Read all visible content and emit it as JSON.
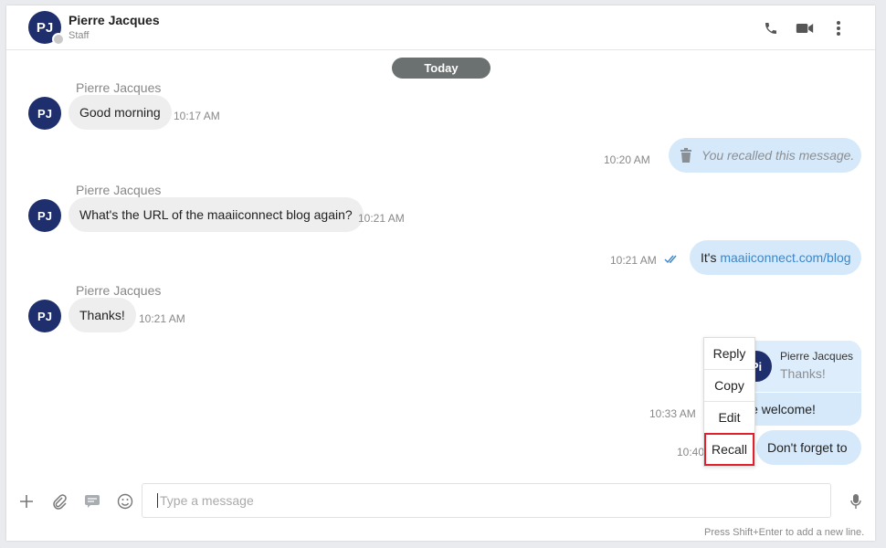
{
  "header": {
    "avatar_initials": "PJ",
    "name": "Pierre Jacques",
    "role": "Staff",
    "icons": [
      "phone-icon",
      "video-camera-icon",
      "more-vertical-icon"
    ]
  },
  "date_divider": "Today",
  "messages": [
    {
      "direction": "in",
      "sender": "Pierre Jacques",
      "avatar": "PJ",
      "text": "Good morning",
      "time": "10:17 AM"
    },
    {
      "direction": "out",
      "text": "You recalled this message.",
      "time": "10:20 AM",
      "recalled": true
    },
    {
      "direction": "in",
      "sender": "Pierre Jacques",
      "avatar": "PJ",
      "text": "What's the URL of the maaiiconnect blog again?",
      "time": "10:21 AM"
    },
    {
      "direction": "out",
      "text_prefix": "It's ",
      "link": "maaiiconnect.com/blog",
      "time": "10:21 AM",
      "read": true
    },
    {
      "direction": "in",
      "sender": "Pierre Jacques",
      "avatar": "PJ",
      "text": "Thanks!",
      "time": "10:21 AM"
    },
    {
      "direction": "out",
      "quote_sender": "Pierre Jacques",
      "quote_avatar": "Pi",
      "quote_text": "Thanks!",
      "text": "u're welcome!",
      "time": "10:33 AM"
    },
    {
      "direction": "out",
      "text": "Don't forget to",
      "time": "10:40"
    }
  ],
  "context_menu": {
    "items": [
      "Reply",
      "Copy",
      "Edit",
      "Recall"
    ],
    "highlighted": "Recall"
  },
  "composer": {
    "placeholder": "Type a message",
    "hint": "Press Shift+Enter to add a new line.",
    "icons": [
      "plus-icon",
      "paperclip-icon",
      "canned-response-icon",
      "emoji-icon",
      "microphone-icon"
    ]
  },
  "colors": {
    "avatar_bg": "#1f2f6e",
    "outgoing_bubble": "#d6e9fb",
    "incoming_bubble": "#eeeeee",
    "link": "#3c86c9",
    "highlight_border": "#e0202a"
  }
}
